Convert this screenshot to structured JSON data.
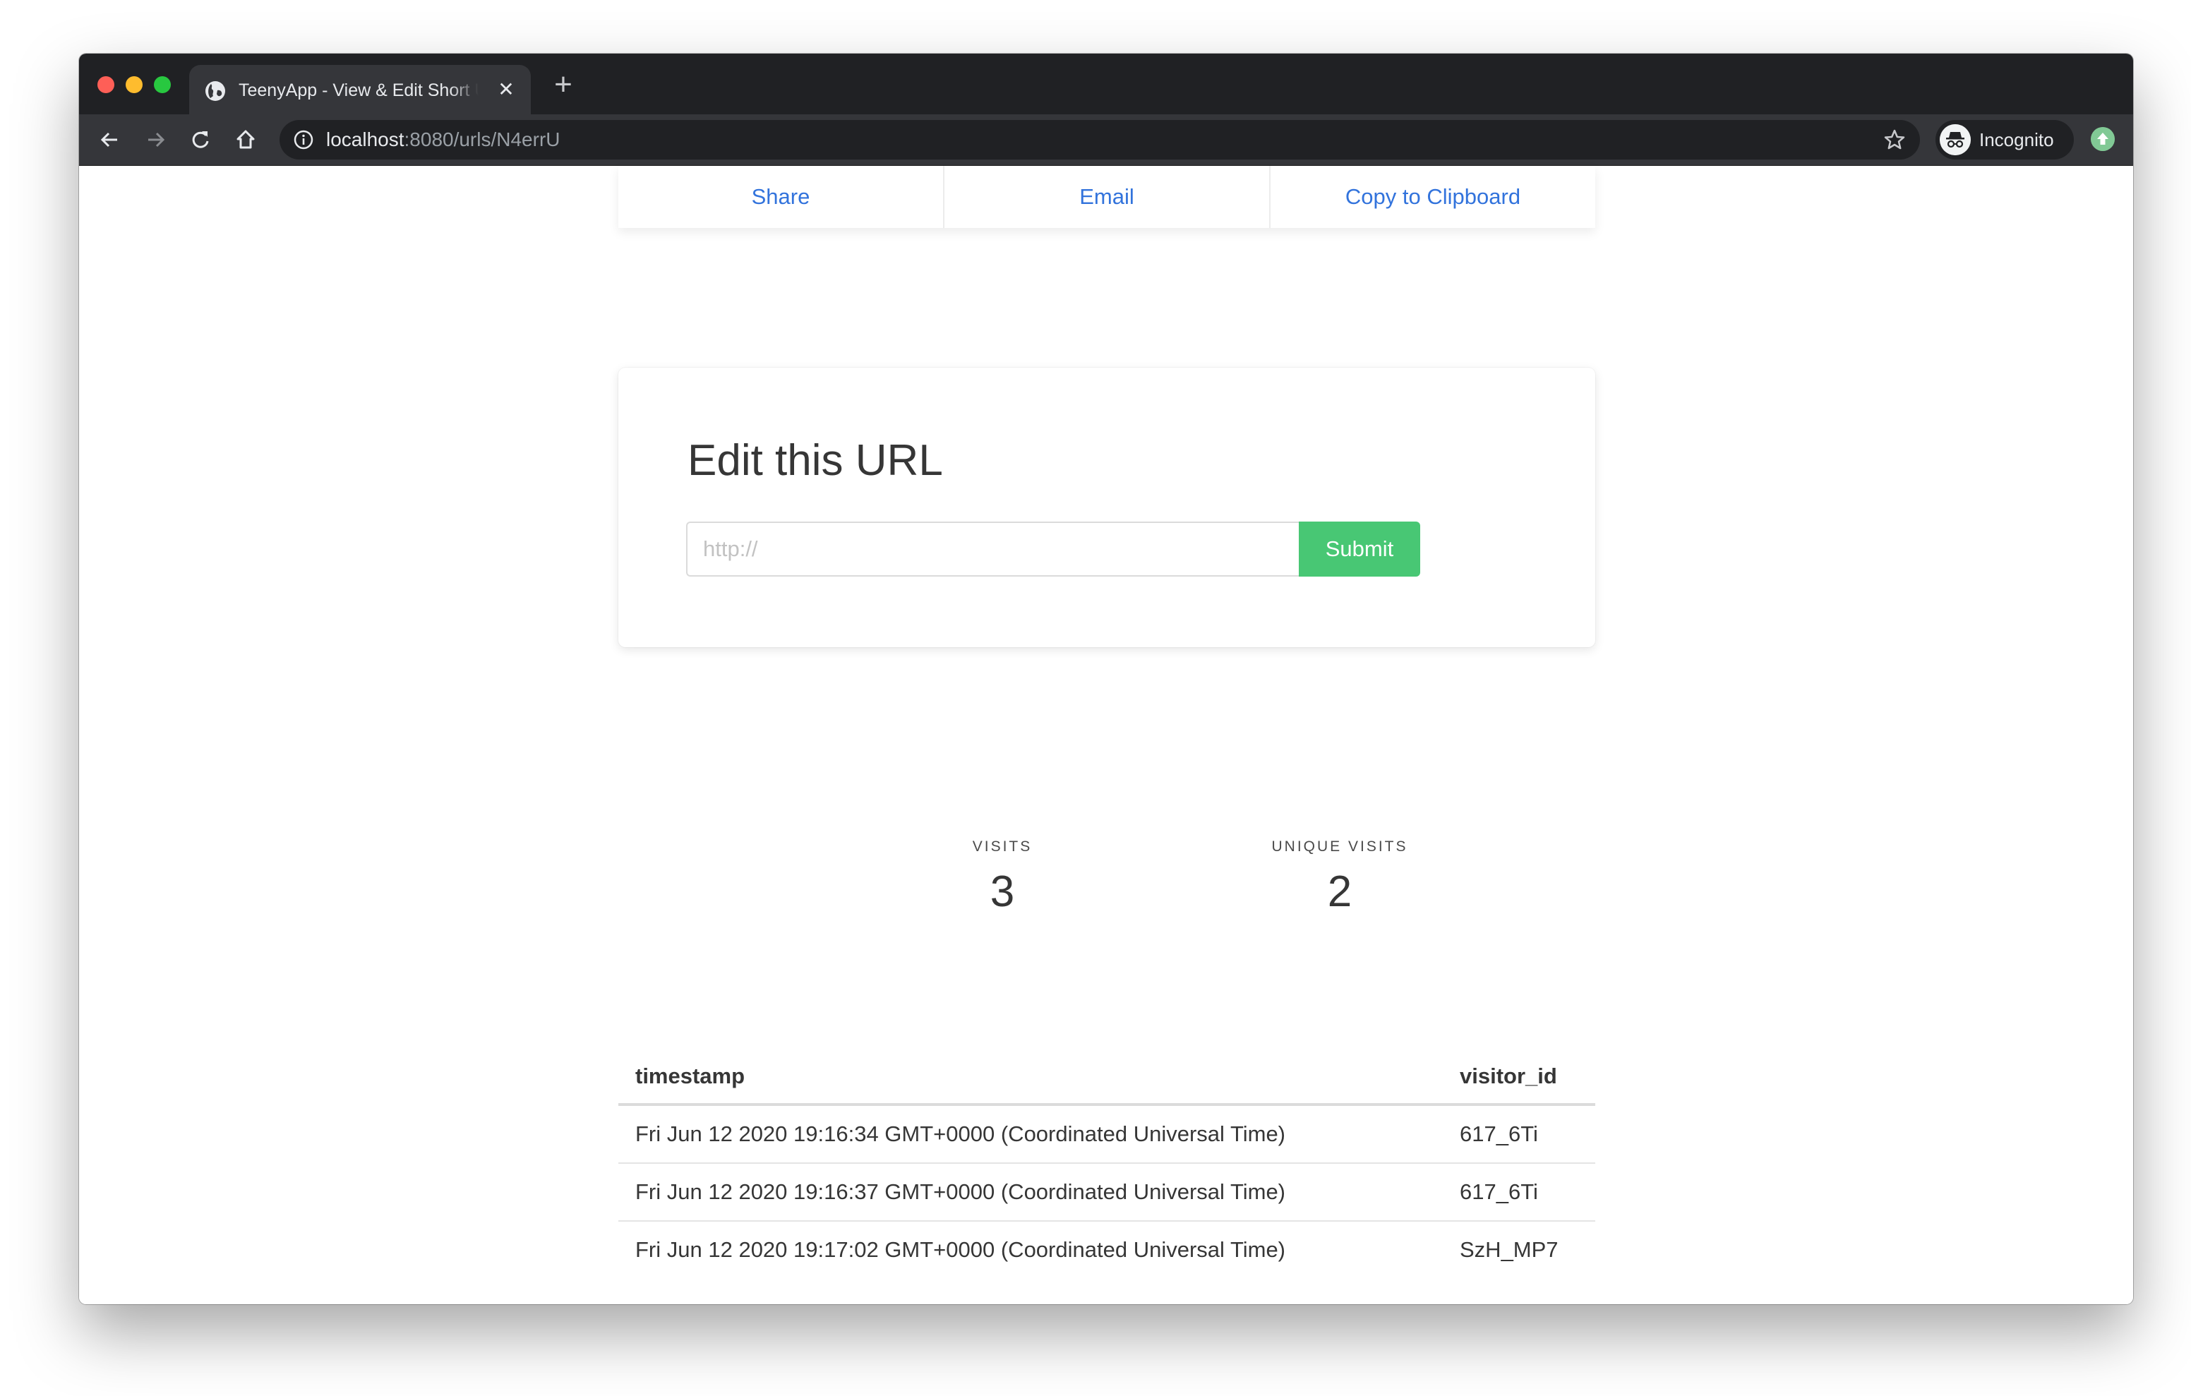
{
  "browser": {
    "tab": {
      "title": "TeenyApp - View & Edit Short URL",
      "icon": "globe-icon",
      "close_icon": "close-icon"
    },
    "new_tab_icon": "plus-icon",
    "url": {
      "host": "localhost",
      "rest": ":8080/urls/N4errU"
    },
    "profile_label": "Incognito",
    "icons": {
      "back": "arrow-left-icon",
      "forward": "arrow-right-icon",
      "reload": "reload-icon",
      "home": "home-icon",
      "info": "info-icon",
      "bookmark": "star-icon",
      "update": "update-arrow-icon"
    }
  },
  "share_bar": {
    "items": [
      {
        "label": "Share"
      },
      {
        "label": "Email"
      },
      {
        "label": "Copy to Clipboard"
      }
    ]
  },
  "edit_form": {
    "title": "Edit this URL",
    "input": {
      "value": "",
      "placeholder": "http://"
    },
    "submit_label": "Submit"
  },
  "stats": {
    "visits": {
      "label": "VISITS",
      "value": "3"
    },
    "unique_visits": {
      "label": "UNIQUE VISITS",
      "value": "2"
    }
  },
  "visits_table": {
    "columns": [
      "timestamp",
      "visitor_id"
    ],
    "rows": [
      {
        "timestamp": "Fri Jun 12 2020 19:16:34 GMT+0000 (Coordinated Universal Time)",
        "visitor_id": "617_6Ti"
      },
      {
        "timestamp": "Fri Jun 12 2020 19:16:37 GMT+0000 (Coordinated Universal Time)",
        "visitor_id": "617_6Ti"
      },
      {
        "timestamp": "Fri Jun 12 2020 19:17:02 GMT+0000 (Coordinated Universal Time)",
        "visitor_id": "SzH_MP7"
      }
    ]
  },
  "colors": {
    "link_blue": "#3273dc",
    "submit_green": "#48c774",
    "text_dark": "#363636",
    "chrome_dark": "#202124",
    "chrome_toolbar": "#35363a"
  }
}
